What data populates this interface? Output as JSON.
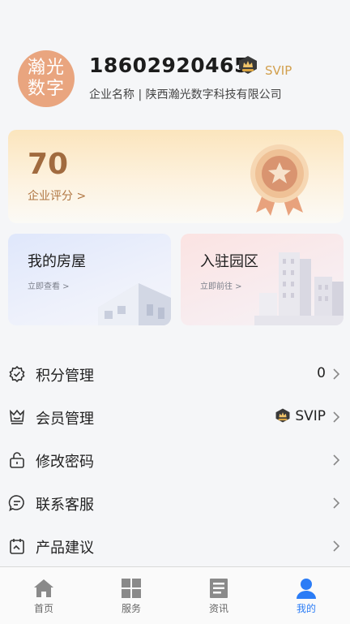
{
  "profile": {
    "avatar_line1": "瀚光",
    "avatar_line2": "数字",
    "phone": "18602920465",
    "vip_level": "SVIP",
    "company": "企业名称 | 陕西瀚光数字科技有限公司"
  },
  "score_card": {
    "value": "70",
    "label": "企业评分 >"
  },
  "tiles": [
    {
      "title": "我的房屋",
      "sub": "立即查看 >"
    },
    {
      "title": "入驻园区",
      "sub": "立即前往 >"
    }
  ],
  "menu": [
    {
      "label": "积分管理",
      "value": "0",
      "icon": "points-icon"
    },
    {
      "label": "会员管理",
      "value": "SVIP",
      "icon": "member-icon"
    },
    {
      "label": "修改密码",
      "value": "",
      "icon": "lock-icon"
    },
    {
      "label": "联系客服",
      "value": "",
      "icon": "chat-icon"
    },
    {
      "label": "产品建议",
      "value": "",
      "icon": "feedback-icon"
    }
  ],
  "tabbar": [
    {
      "label": "首页",
      "icon": "home-icon"
    },
    {
      "label": "服务",
      "icon": "grid-icon"
    },
    {
      "label": "资讯",
      "icon": "news-icon"
    },
    {
      "label": "我的",
      "icon": "user-icon",
      "active": true
    }
  ],
  "colors": {
    "accent": "#2b7cf6",
    "vip_gold": "#d2a04e",
    "score_brown": "#a16b3f",
    "avatar_bg": "#e9a57f"
  }
}
